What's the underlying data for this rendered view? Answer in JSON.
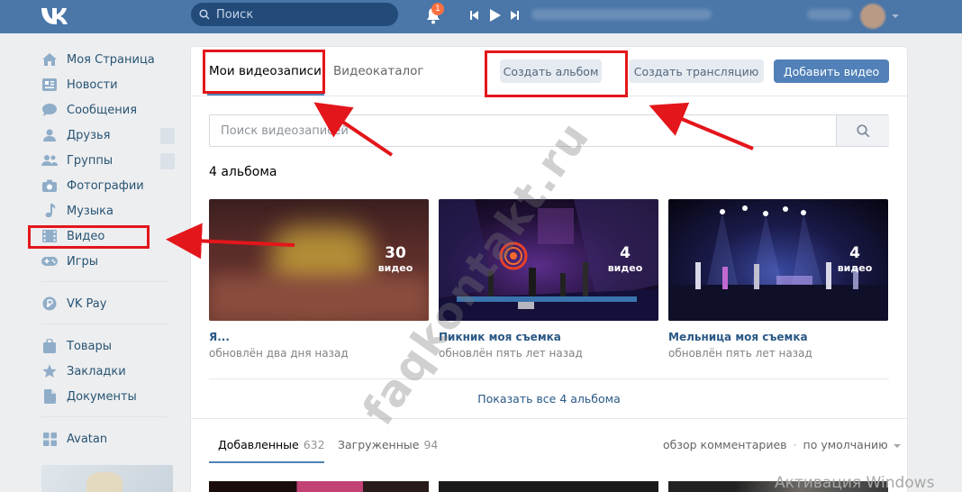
{
  "header": {
    "search_placeholder": "Поиск",
    "notification_count": "1",
    "colors": {
      "bar": "#4a76a8",
      "search_bg": "#224b7a",
      "badge": "#ff7043"
    }
  },
  "sidebar": {
    "items": [
      {
        "label": "Моя Страница",
        "icon": "home-icon"
      },
      {
        "label": "Новости",
        "icon": "news-icon"
      },
      {
        "label": "Сообщения",
        "icon": "messages-icon"
      },
      {
        "label": "Друзья",
        "icon": "user-icon"
      },
      {
        "label": "Группы",
        "icon": "users-icon"
      },
      {
        "label": "Фотографии",
        "icon": "camera-icon"
      },
      {
        "label": "Музыка",
        "icon": "music-note-icon"
      },
      {
        "label": "Видео",
        "icon": "film-icon"
      },
      {
        "label": "Игры",
        "icon": "gamepad-icon"
      },
      {
        "label": "VK Pay",
        "icon": "rouble-icon"
      },
      {
        "label": "Товары",
        "icon": "bag-icon"
      },
      {
        "label": "Закладки",
        "icon": "star-icon"
      },
      {
        "label": "Документы",
        "icon": "document-icon"
      },
      {
        "label": "Avatan",
        "icon": "apps-icon"
      }
    ]
  },
  "video": {
    "tabs": {
      "my": "Мои видеозаписи",
      "catalog": "Видеокаталог"
    },
    "buttons": {
      "create_album": "Создать альбом",
      "create_stream": "Создать трансляцию",
      "add_video": "Добавить видео"
    },
    "search_placeholder": "Поиск видеозаписей",
    "albums_count": "4 альбома",
    "albums": [
      {
        "title": "Я...",
        "count": "30",
        "count_label": "видео",
        "updated": "обновлён два дня назад"
      },
      {
        "title": "Пикник моя съемка",
        "count": "4",
        "count_label": "видео",
        "updated": "обновлён пять лет назад"
      },
      {
        "title": "Мельница моя съемка",
        "count": "4",
        "count_label": "видео",
        "updated": "обновлён пять лет назад"
      }
    ],
    "show_all": "Показать все 4 альбома",
    "subtabs": {
      "added_label": "Добавленные",
      "added_count": "632",
      "uploaded_label": "Загруженные",
      "uploaded_count": "94"
    },
    "sort": {
      "comments": "обзор комментариев",
      "default": "по умолчанию"
    }
  },
  "overlay": {
    "watermark": "faqkontakt.ru",
    "windows_activation": "Активация Windows",
    "annotation_color": "#e3161b"
  }
}
